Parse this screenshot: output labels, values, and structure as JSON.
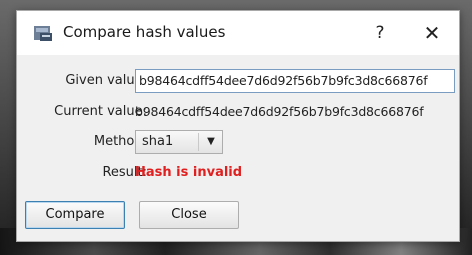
{
  "dialog": {
    "title": "Compare hash values",
    "help_label": "?",
    "close_label": "✕"
  },
  "fields": {
    "given_label": "Given value:",
    "given_value": "b98464cdff54dee7d6d92f56b7b9fc3d8c66876f",
    "current_label": "Current value:",
    "current_value": "b98464cdff54dee7d6d92f56b7b9fc3d8c66876f",
    "method_label": "Method:",
    "method_value": "sha1",
    "method_arrow": "▼",
    "result_label": "Result:",
    "result_value": "Hash is invalid"
  },
  "buttons": {
    "compare": "Compare",
    "close": "Close"
  },
  "colors": {
    "result_invalid": "#e02020",
    "accent_border": "#3c7fb1"
  }
}
